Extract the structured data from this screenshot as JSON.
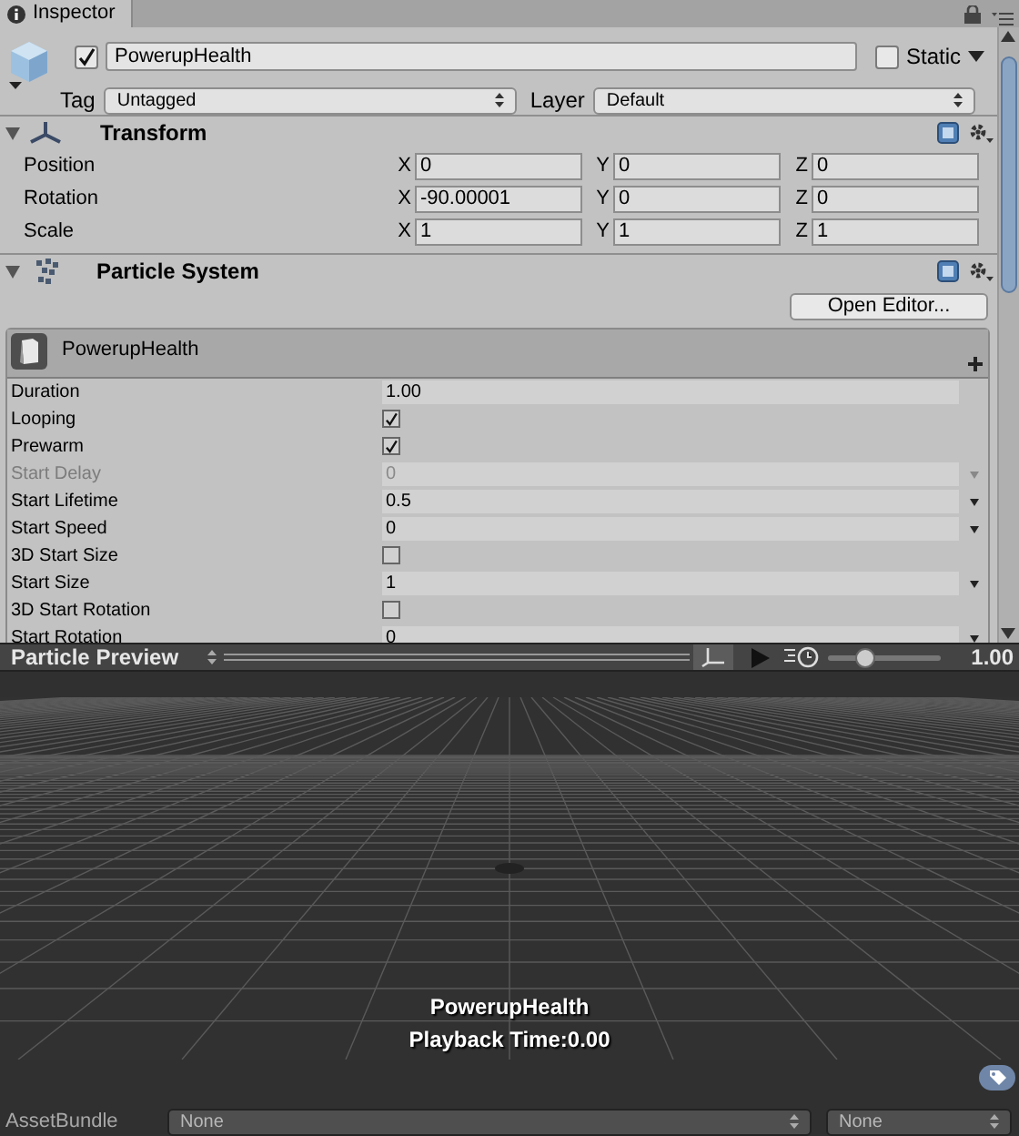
{
  "tab": {
    "label": "Inspector"
  },
  "object": {
    "active": true,
    "name": "PowerupHealth",
    "static": false,
    "static_label": "Static",
    "tag_label": "Tag",
    "tag": "Untagged",
    "layer_label": "Layer",
    "layer": "Default"
  },
  "transform": {
    "title": "Transform",
    "expanded": true,
    "rows": [
      {
        "label": "Position",
        "fields": [
          {
            "axis": "X",
            "value": "0"
          },
          {
            "axis": "Y",
            "value": "0"
          },
          {
            "axis": "Z",
            "value": "0"
          }
        ]
      },
      {
        "label": "Rotation",
        "fields": [
          {
            "axis": "X",
            "value": "-90.00001"
          },
          {
            "axis": "Y",
            "value": "0"
          },
          {
            "axis": "Z",
            "value": "0"
          }
        ]
      },
      {
        "label": "Scale",
        "fields": [
          {
            "axis": "X",
            "value": "1"
          },
          {
            "axis": "Y",
            "value": "1"
          },
          {
            "axis": "Z",
            "value": "1"
          }
        ]
      }
    ]
  },
  "particle_system": {
    "title": "Particle System",
    "expanded": true,
    "open_editor": "Open Editor...",
    "module_title": "PowerupHealth",
    "properties": [
      {
        "kind": "value",
        "label": "Duration",
        "value": "1.00",
        "dropdown": false,
        "disabled": false
      },
      {
        "kind": "checkbox",
        "label": "Looping",
        "checked": true,
        "disabled": false
      },
      {
        "kind": "checkbox",
        "label": "Prewarm",
        "checked": true,
        "disabled": false
      },
      {
        "kind": "value",
        "label": "Start Delay",
        "value": "0",
        "dropdown": true,
        "disabled": true
      },
      {
        "kind": "value",
        "label": "Start Lifetime",
        "value": "0.5",
        "dropdown": true,
        "disabled": false
      },
      {
        "kind": "value",
        "label": "Start Speed",
        "value": "0",
        "dropdown": true,
        "disabled": false
      },
      {
        "kind": "checkbox",
        "label": "3D Start Size",
        "checked": false,
        "disabled": false
      },
      {
        "kind": "value",
        "label": "Start Size",
        "value": "1",
        "dropdown": true,
        "disabled": false
      },
      {
        "kind": "checkbox",
        "label": "3D Start Rotation",
        "checked": false,
        "disabled": false
      },
      {
        "kind": "value",
        "label": "Start Rotation",
        "value": "0",
        "dropdown": true,
        "disabled": false
      }
    ]
  },
  "preview": {
    "title": "Particle Preview",
    "level": 0.33,
    "speed": "1.00",
    "object_name": "PowerupHealth",
    "playback_time": "Playback Time:0.00"
  },
  "asset_bundle": {
    "label": "AssetBundle",
    "bundle": "None",
    "variant": "None"
  }
}
